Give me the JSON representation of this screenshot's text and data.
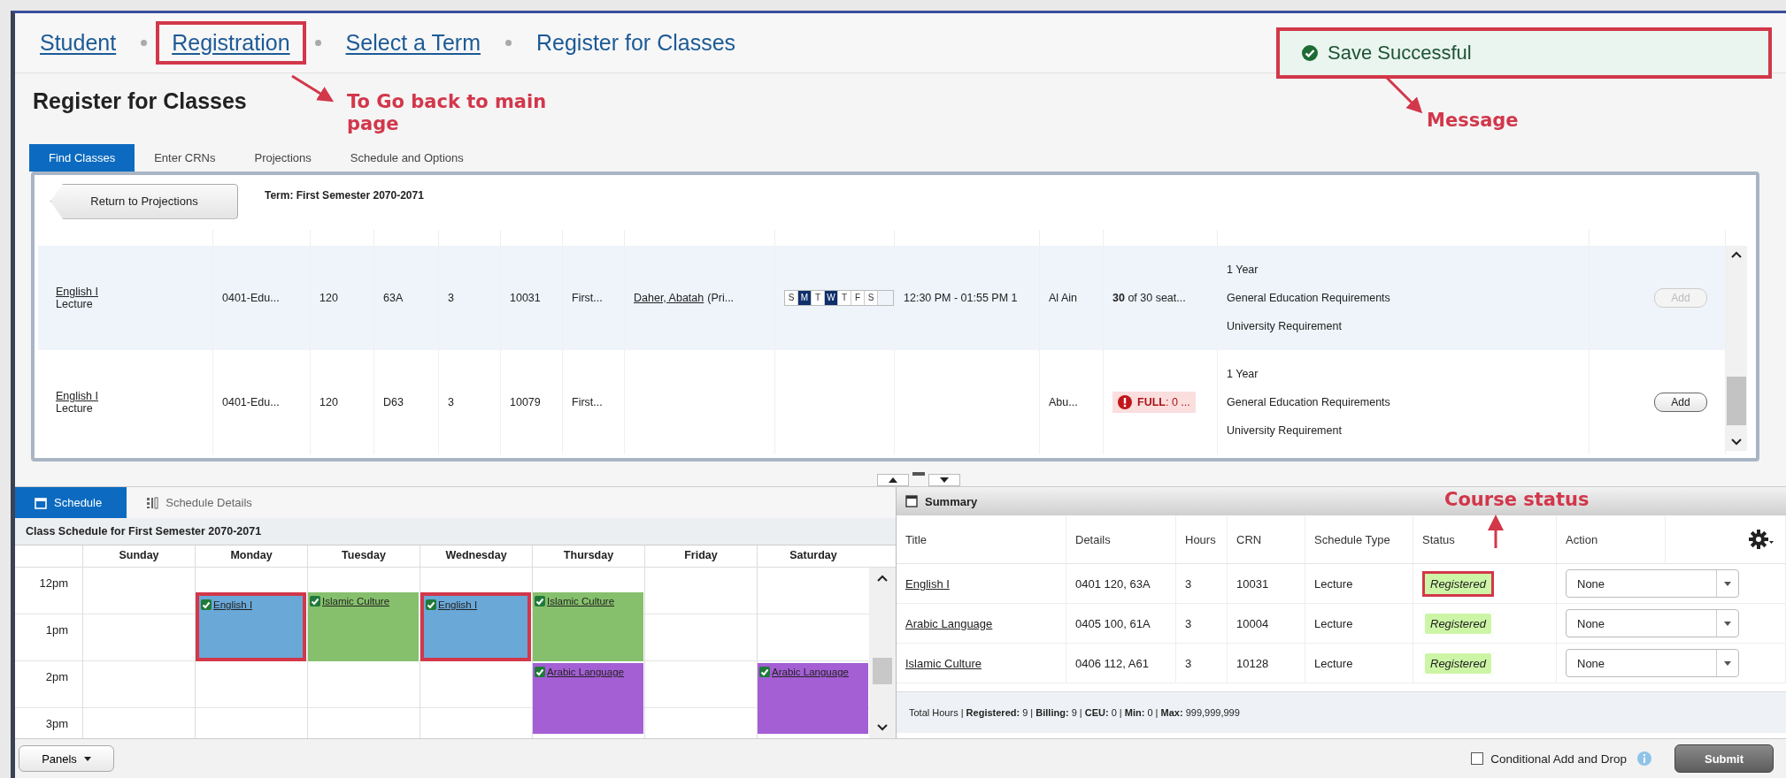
{
  "breadcrumbs": [
    {
      "label": "Student",
      "highlighted": false
    },
    {
      "label": "Registration",
      "highlighted": true
    },
    {
      "label": "Select a Term",
      "highlighted": false
    },
    {
      "label": "Register for Classes",
      "highlighted": false
    }
  ],
  "message": {
    "text": "Save Successful",
    "highlighted": true
  },
  "page_title": "Register for Classes",
  "tabs": [
    {
      "label": "Find Classes",
      "selected": true
    },
    {
      "label": "Enter CRNs",
      "selected": false
    },
    {
      "label": "Projections",
      "selected": false
    },
    {
      "label": "Schedule and Options",
      "selected": false
    }
  ],
  "return_button": "Return to Projections",
  "term": "Term: First Semester 2070-2071",
  "classes": [
    {
      "title": "English I",
      "type": "Lecture",
      "subject": "0401-Edu...",
      "course": "120",
      "section": "63A",
      "hours": "3",
      "crn": "10031",
      "term": "First...",
      "instructor": {
        "name": "Daher, Abatah",
        "role": "(Pri..."
      },
      "days": [
        {
          "label": "S",
          "selected": false
        },
        {
          "label": "M",
          "selected": true
        },
        {
          "label": "T",
          "selected": false
        },
        {
          "label": "W",
          "selected": true
        },
        {
          "label": "T",
          "selected": false
        },
        {
          "label": "F",
          "selected": false
        },
        {
          "label": "S",
          "selected": false
        }
      ],
      "time": "12:30 PM - 01:55 PM 1",
      "campus": "Al Ain",
      "status": {
        "kind": "seats",
        "text": "**30** of 30 seat..."
      },
      "attributes": [
        "1 Year",
        "General Education Requirements",
        "University Requirement"
      ],
      "add": {
        "label": "Add",
        "disabled": true
      },
      "selected": true
    },
    {
      "title": "English I",
      "type": "Lecture",
      "subject": "0401-Edu...",
      "course": "120",
      "section": "D63",
      "hours": "3",
      "crn": "10079",
      "term": "First...",
      "campus": "Abu...",
      "status": {
        "kind": "full",
        "text": "**FULL**: 0 ..."
      },
      "attributes": [
        "1 Year",
        "General Education Requirements",
        "University Requirement"
      ],
      "add": {
        "label": "Add",
        "disabled": false
      },
      "selected": false
    }
  ],
  "schedule": {
    "tabs": [
      {
        "label": "Schedule",
        "selected": true
      },
      {
        "label": "Schedule Details",
        "selected": false
      }
    ],
    "caption": "Class Schedule for First Semester 2070-2071",
    "times": [
      "12pm",
      "1pm",
      "2pm",
      "3pm"
    ],
    "days": [
      {
        "label": "Sunday"
      },
      {
        "label": "Monday",
        "events": [
          {
            "title": "English I",
            "color": "#6aa8d8",
            "kind": "noon",
            "highlighted": true
          }
        ]
      },
      {
        "label": "Tuesday",
        "events": [
          {
            "title": "Islamic Culture",
            "color": "#86c06c",
            "kind": "noon",
            "highlighted": false
          }
        ]
      },
      {
        "label": "Wednesday",
        "events": [
          {
            "title": "English I",
            "color": "#6aa8d8",
            "kind": "noon",
            "highlighted": true
          }
        ]
      },
      {
        "label": "Thursday",
        "events": [
          {
            "title": "Islamic Culture",
            "color": "#86c06c",
            "kind": "noon",
            "highlighted": false
          },
          {
            "title": "Arabic Language",
            "color": "#a45fd4",
            "kind": "afternoon",
            "highlighted": false
          }
        ]
      },
      {
        "label": "Friday"
      },
      {
        "label": "Saturday",
        "events": [
          {
            "title": "Arabic Language",
            "color": "#a45fd4",
            "kind": "afternoon",
            "highlighted": false
          }
        ]
      }
    ]
  },
  "summary": {
    "title": "Summary",
    "columns": [
      "Title",
      "Details",
      "Hours",
      "CRN",
      "Schedule Type",
      "Status",
      "Action"
    ],
    "rows": [
      {
        "title": "English I",
        "details": "0401 120, 63A",
        "hours": "3",
        "crn": "10031",
        "type": "Lecture",
        "status": "Registered",
        "action": "None",
        "highlighted": true
      },
      {
        "title": "Arabic Language",
        "details": "0405 100, 61A",
        "hours": "3",
        "crn": "10004",
        "type": "Lecture",
        "status": "Registered",
        "action": "None",
        "highlighted": false
      },
      {
        "title": "Islamic Culture",
        "details": "0406 112, A61",
        "hours": "3",
        "crn": "10128",
        "type": "Lecture",
        "status": "Registered",
        "action": "None",
        "highlighted": false
      }
    ],
    "totals": "Total Hours | **Registered:** 9 | **Billing:** 9 | **CEU:** 0 | **Min:** 0 | **Max:** 999,999,999"
  },
  "footer": {
    "panels_button": "Panels",
    "conditional": {
      "label": "Conditional Add and Drop",
      "checked": false
    },
    "submit": "Submit"
  },
  "annotations": [
    {
      "text": "To Go back to main page",
      "kind": "breadcrumb"
    },
    {
      "text": "Message",
      "kind": "message"
    },
    {
      "text": "Course status",
      "kind": "status"
    }
  ]
}
